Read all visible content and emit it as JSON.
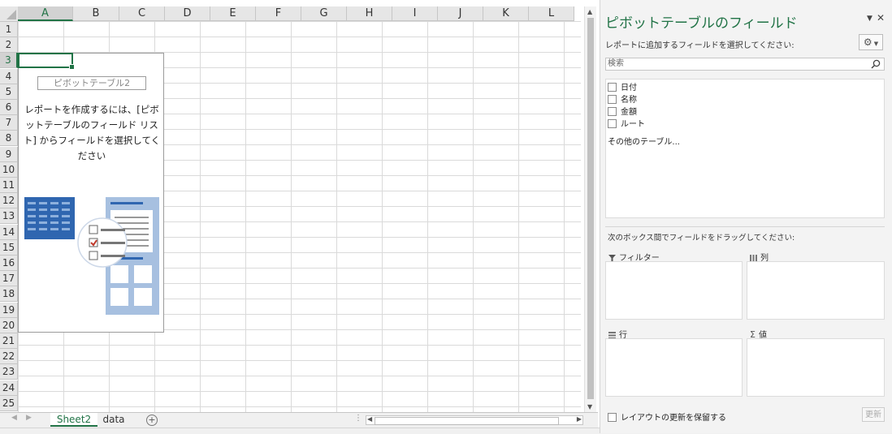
{
  "spreadsheet": {
    "columns": [
      "A",
      "B",
      "C",
      "D",
      "E",
      "F",
      "G",
      "H",
      "I",
      "J",
      "K",
      "L"
    ],
    "rows": [
      "1",
      "2",
      "3",
      "4",
      "5",
      "6",
      "7",
      "8",
      "9",
      "10",
      "11",
      "12",
      "13",
      "14",
      "15",
      "16",
      "17",
      "18",
      "19",
      "20",
      "21",
      "22",
      "23",
      "24",
      "25"
    ],
    "selected_cell": "A3"
  },
  "pivot_placeholder": {
    "name": "ピボットテーブル2",
    "message": "レポートを作成するには、[ピボットテーブルのフィールド リスト] からフィールドを選択してください"
  },
  "sheet_tabs": {
    "tabs": [
      "Sheet2",
      "data"
    ],
    "active": "Sheet2",
    "add_icon": "plus-circle-icon"
  },
  "field_panel": {
    "title": "ピボットテーブルのフィールド",
    "subtitle": "レポートに追加するフィールドを選択してください:",
    "search_placeholder": "検索",
    "fields": [
      {
        "label": "日付",
        "checked": false
      },
      {
        "label": "名称",
        "checked": false
      },
      {
        "label": "金額",
        "checked": false
      },
      {
        "label": "ルート",
        "checked": false
      }
    ],
    "more_tables": "その他のテーブル...",
    "drag_instruction": "次のボックス間でフィールドをドラッグしてください:",
    "areas": {
      "filter": "フィルター",
      "columns": "列",
      "rows": "行",
      "values": "値"
    },
    "defer_update": "レイアウトの更新を保留する",
    "update_button": "更新"
  },
  "colors": {
    "accent": "#217346",
    "panel_bg": "#f3f3f3",
    "header_bg": "#e6e6e6"
  }
}
